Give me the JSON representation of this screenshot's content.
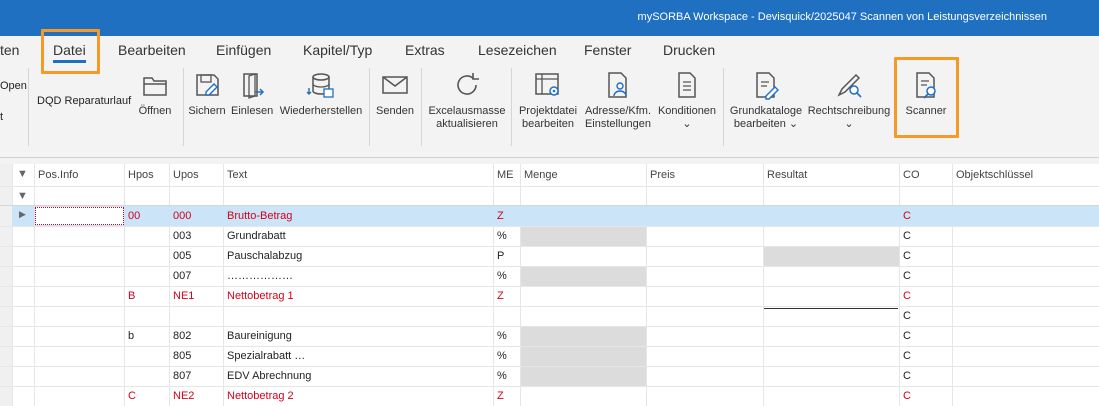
{
  "window": {
    "title": "mySORBA Workspace - Devisquick/2025047 Scannen von Leistungsverzeichnissen"
  },
  "menu": [
    "ten",
    "Datei",
    "Bearbeiten",
    "Einfügen",
    "Kapitel/Typ",
    "Extras",
    "Lesezeichen",
    "Fenster",
    "Drucken"
  ],
  "ribbon": {
    "partial": [
      "Open",
      "t"
    ],
    "dqd": "DQD Reparaturlauf",
    "buttons": {
      "oeffnen": "Öffnen",
      "sichern": "Sichern",
      "einlesen": "Einlesen",
      "wiederherstellen": "Wiederherstellen",
      "senden": "Senden",
      "excel1": "Excelausmasse",
      "excel2": "aktualisieren",
      "projekt1": "Projektdatei",
      "projekt2": "bearbeiten",
      "adresse1": "Adresse/Kfm.",
      "adresse2": "Einstellungen",
      "konditionen": "Konditionen",
      "grund1": "Grundkataloge",
      "grund2": "bearbeiten",
      "recht": "Rechtschreibung",
      "scanner": "Scanner"
    }
  },
  "grid": {
    "columns": [
      "Pos.Info",
      "Hpos",
      "Upos",
      "Text",
      "ME",
      "Menge",
      "Preis",
      "Resultat",
      "CO",
      "Objektschlüssel"
    ],
    "rows": [
      {
        "hpos": "00",
        "upos": "000",
        "text": "Brutto-Betrag",
        "me": "Z",
        "co": "C",
        "red": true
      },
      {
        "hpos": "",
        "upos": "003",
        "text": "Grundrabatt",
        "me": "%",
        "co": "C",
        "red": false
      },
      {
        "hpos": "",
        "upos": "005",
        "text": "Pauschalabzug",
        "me": "P",
        "co": "C",
        "red": false
      },
      {
        "hpos": "",
        "upos": "007",
        "text": "………………",
        "me": "%",
        "co": "C",
        "red": false
      },
      {
        "hpos": "B",
        "upos": "NE1",
        "text": "Nettobetrag 1",
        "me": "Z",
        "co": "C",
        "red": true
      },
      {
        "hpos": "",
        "upos": "",
        "text": "",
        "me": "",
        "co": "C",
        "red": false
      },
      {
        "hpos": "b",
        "upos": "802",
        "text": "Baureinigung",
        "me": "%",
        "co": "C",
        "red": false
      },
      {
        "hpos": "",
        "upos": "805",
        "text": "Spezialrabatt …",
        "me": "%",
        "co": "C",
        "red": false
      },
      {
        "hpos": "",
        "upos": "807",
        "text": "EDV Abrechnung",
        "me": "%",
        "co": "C",
        "red": false
      },
      {
        "hpos": "C",
        "upos": "NE2",
        "text": "Nettobetrag 2",
        "me": "Z",
        "co": "C",
        "red": true
      }
    ]
  }
}
